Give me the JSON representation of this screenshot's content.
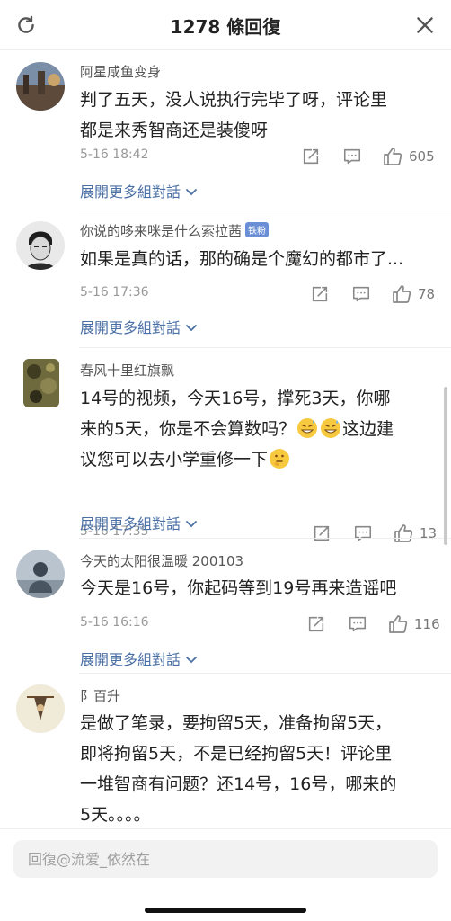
{
  "header": {
    "title": "1278 條回復",
    "left_icon": "refresh-icon",
    "right_icon": "close-icon"
  },
  "comments": [
    {
      "username": "阿星咸鱼变身",
      "text_lines": [
        "判了五天，没人说执行完毕了呀，评论里",
        "都是来秀智商还是装傻呀"
      ],
      "time": "5-16 18:42",
      "likes": "605",
      "expand": "展開更多組對話"
    },
    {
      "username": "你说的哆来咪是什么索拉茜",
      "badge": "铁粉",
      "text_lines": [
        "如果是真的话，那的确是个魔幻的都市了..."
      ],
      "time": "5-16 17:36",
      "likes": "78",
      "expand": "展開更多組對話"
    },
    {
      "username": "春风十里红旗飘",
      "text_lines": [
        "14号的视频，今天16号，撑死3天，你哪",
        "来的5天，你是不会算数吗？",
        "这边建",
        "议您可以去小学重修一下"
      ],
      "time": "5-16 17:35",
      "likes": "13",
      "expand": "展開更多組對話"
    },
    {
      "username": "今天的太阳很温暖 200103",
      "text_lines": [
        "今天是16号，你起码等到19号再来造谣吧"
      ],
      "time": "5-16 16:16",
      "likes": "116",
      "expand": "展開更多組對話"
    },
    {
      "username": "阝百升",
      "text_lines": [
        "是做了笔录，要拘留5天，准备拘留5天，",
        "即将拘留5天，不是已经拘留5天！评论里",
        "一堆智商有问题？还14号，16号，哪来的",
        "5天。。。。"
      ]
    }
  ],
  "footer": {
    "reply_placeholder": "回復@流爱_依然在"
  },
  "colors": {
    "link": "#4a6fa5",
    "meta": "#999999",
    "divider": "#eeeeee"
  }
}
